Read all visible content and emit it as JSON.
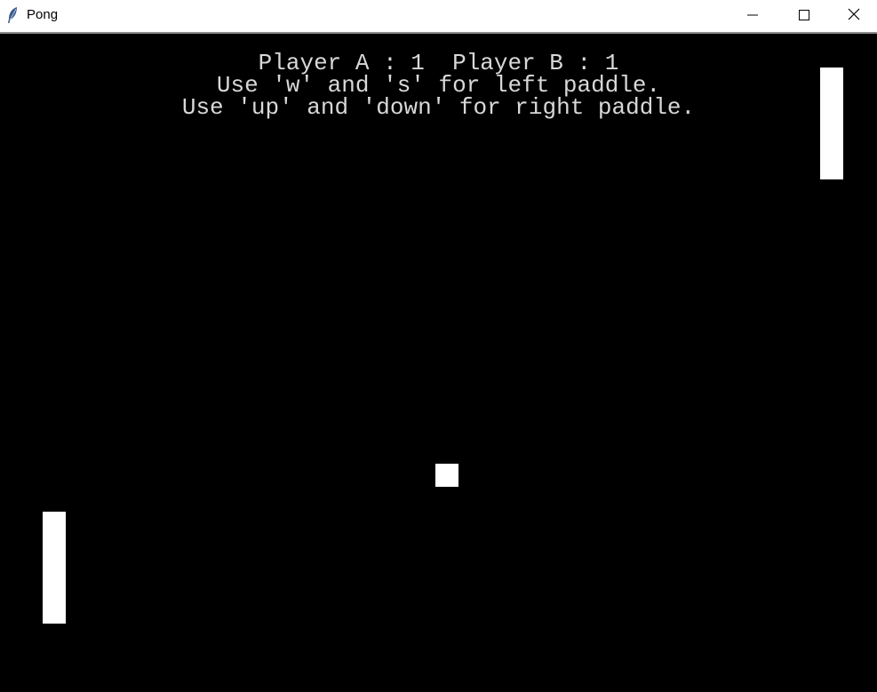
{
  "window": {
    "title": "Pong",
    "icons": {
      "app": "feather-icon",
      "minimize": "minimize-icon",
      "maximize": "maximize-icon",
      "close": "close-icon"
    }
  },
  "game": {
    "background_color": "#000000",
    "foreground_color": "#ffffff",
    "text_color": "#d8d8d8",
    "score_text": "Player A : 1  Player B : 1",
    "player_a_score": 1,
    "player_b_score": 1,
    "help_left": "Use 'w' and 's' for left paddle.",
    "help_right": "Use 'up' and 'down' for right paddle."
  }
}
